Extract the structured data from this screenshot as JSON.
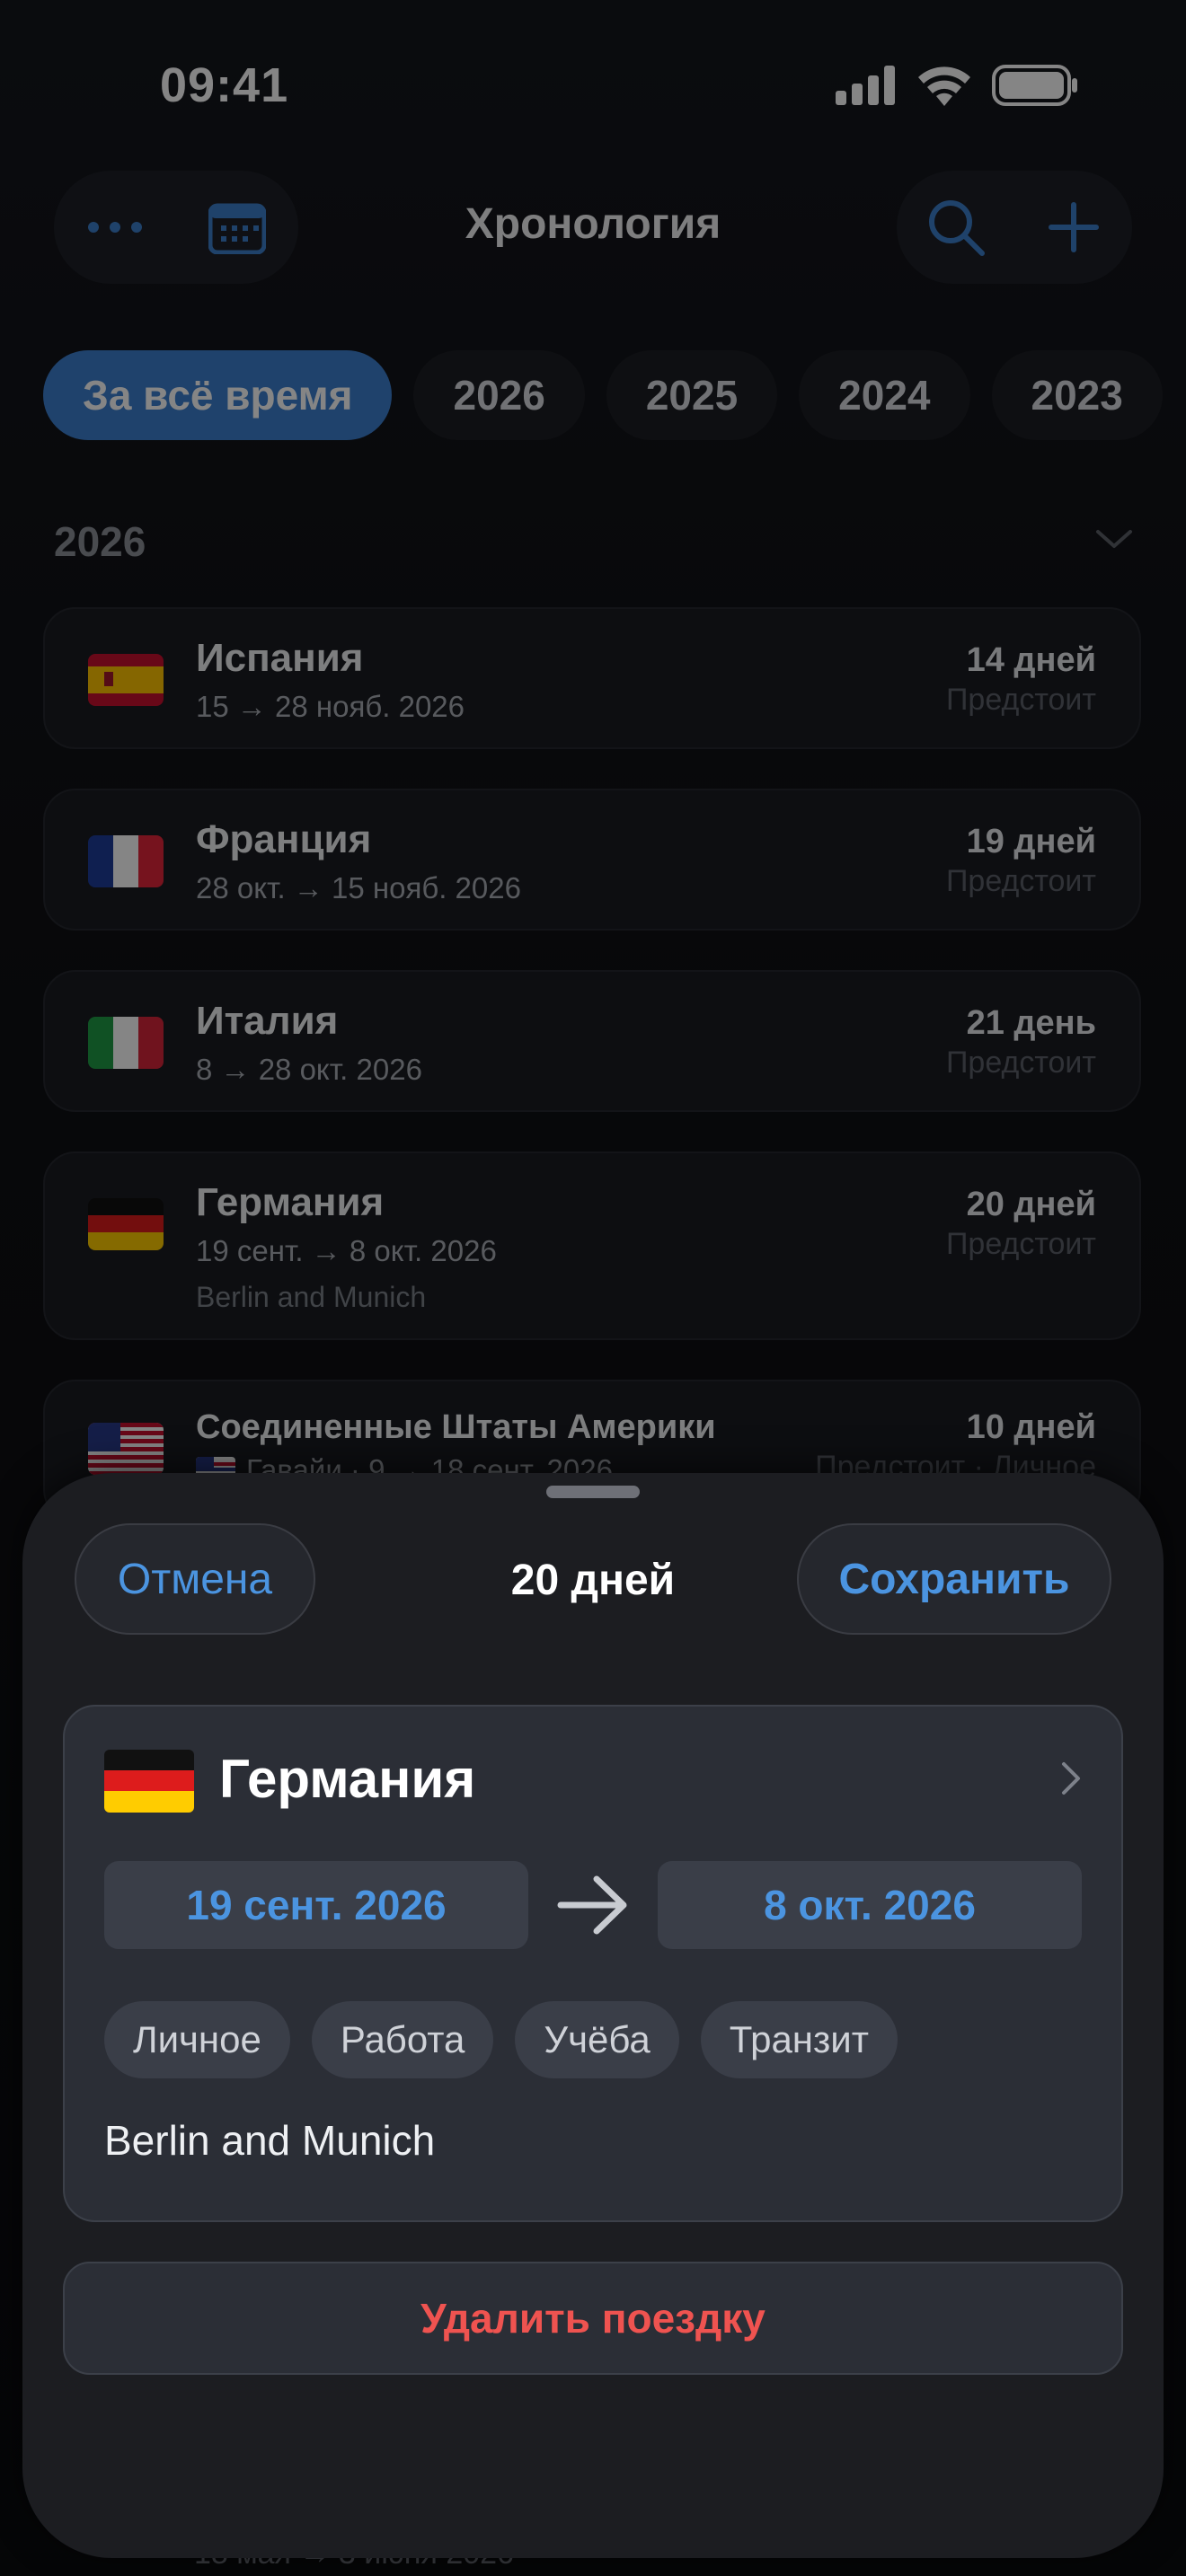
{
  "status_bar": {
    "time": "09:41",
    "icons": [
      "signal-icon",
      "wifi-icon",
      "battery-icon"
    ]
  },
  "nav": {
    "title": "Хронология",
    "left_icons": [
      "more-icon",
      "calendar-icon"
    ],
    "right_icons": [
      "search-icon",
      "plus-icon"
    ]
  },
  "filters": {
    "items": [
      "За всё время",
      "2026",
      "2025",
      "2024",
      "2023"
    ],
    "selected": "За всё время"
  },
  "section": {
    "year": "2026"
  },
  "trips": [
    {
      "flag": "spain",
      "country": "Испания",
      "dates": "15 → 28 нояб. 2026",
      "days": "14 дней",
      "status": "Предстоит"
    },
    {
      "flag": "france",
      "country": "Франция",
      "dates": "28 окт. → 15 нояб. 2026",
      "days": "19 дней",
      "status": "Предстоит"
    },
    {
      "flag": "italy",
      "country": "Италия",
      "dates": "8 → 28 окт. 2026",
      "days": "21 день",
      "status": "Предстоит"
    },
    {
      "flag": "germany",
      "country": "Германия",
      "dates": "19 сент. → 8 окт. 2026",
      "note": "Berlin and Munich",
      "days": "20 дней",
      "status": "Предстоит"
    },
    {
      "flag": "usa",
      "country": "Соединенные Штаты Америки",
      "dates": "Гавайи · 9 → 18 сент. 2026",
      "days": "10 дней",
      "status": "Предстоит · Личное"
    }
  ],
  "peek_text": "18 мая → 3 июня 2026",
  "sheet": {
    "cancel": "Отмена",
    "title": "20 дней",
    "save": "Сохранить",
    "country": "Германия",
    "start_date": "19 сент. 2026",
    "end_date": "8 окт. 2026",
    "tags": [
      "Личное",
      "Работа",
      "Учёба",
      "Транзит"
    ],
    "note": "Berlin and Munich",
    "delete": "Удалить поездку"
  },
  "colors": {
    "accent": "#4b94e0",
    "danger": "#ef5350",
    "chip_active": "#3c7fd0"
  }
}
